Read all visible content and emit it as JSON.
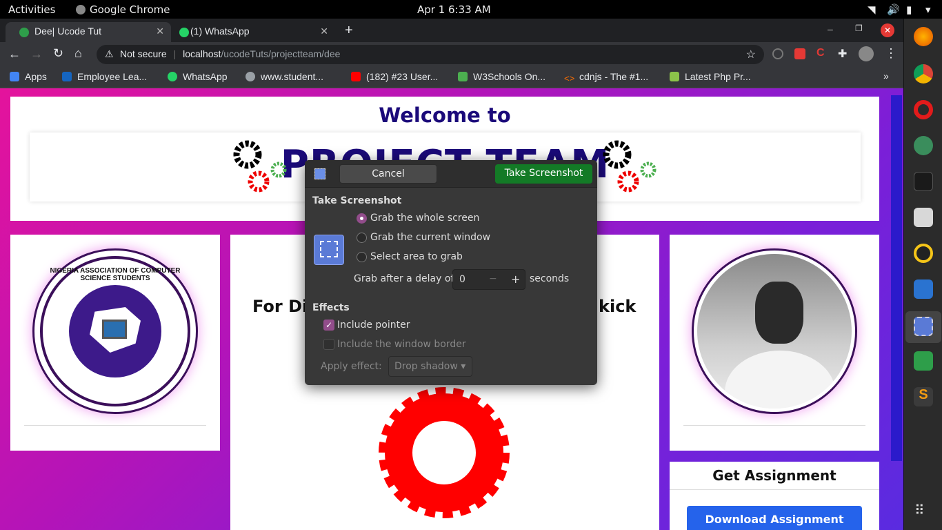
{
  "system_bar": {
    "activities": "Activities",
    "app_name": "Google Chrome",
    "clock": "Apr 1   6:33 AM"
  },
  "tabs": [
    {
      "title": "Dee| Ucode Tut",
      "active": true
    },
    {
      "title": "(1) WhatsApp",
      "active": false
    }
  ],
  "address_bar": {
    "security": "Not secure",
    "host": "localhost",
    "path": "/ucodeTuts/projectteam/dee"
  },
  "bookmarks": [
    {
      "label": "Apps",
      "color": "#4285f4"
    },
    {
      "label": "Employee Lea...",
      "color": "#1565c0"
    },
    {
      "label": "WhatsApp",
      "color": "#25d366"
    },
    {
      "label": "www.student...",
      "color": "#9aa0a6"
    },
    {
      "label": "(182) #23 User...",
      "color": "#ff0000"
    },
    {
      "label": "W3Schools On...",
      "color": "#4caf50"
    },
    {
      "label": "cdnjs - The #1...",
      "color": "#ff6f00"
    },
    {
      "label": "Latest Php Pr...",
      "color": "#8bc34a"
    }
  ],
  "page": {
    "welcome": "Welcome to",
    "banner_title": "PROJECT TEAM",
    "mid_heading_left": "For Dir",
    "mid_heading_right": "kick",
    "logo_ring_text": "NIGERIA ASSOCIATION OF COMPUTER SCIENCE STUDENTS",
    "assignment_title": "Get Assignment",
    "download_button": "Download Assignment"
  },
  "dialog": {
    "cancel": "Cancel",
    "take_screenshot": "Take Screenshot",
    "section_title": "Take Screenshot",
    "options": [
      {
        "label": "Grab the whole screen",
        "selected": true
      },
      {
        "label": "Grab the current window",
        "selected": false
      },
      {
        "label": "Select area to grab",
        "selected": false
      }
    ],
    "delay_label": "Grab after a delay of",
    "delay_value": "0",
    "delay_unit": "seconds",
    "effects_title": "Effects",
    "include_pointer": "Include pointer",
    "include_border": "Include the window border",
    "apply_effect_label": "Apply effect:",
    "apply_effect_value": "Drop shadow"
  },
  "colors": {
    "accent": "#924d8b",
    "primary_button": "#137a26",
    "page_title": "#1b0a7a",
    "download_button": "#2563eb"
  }
}
